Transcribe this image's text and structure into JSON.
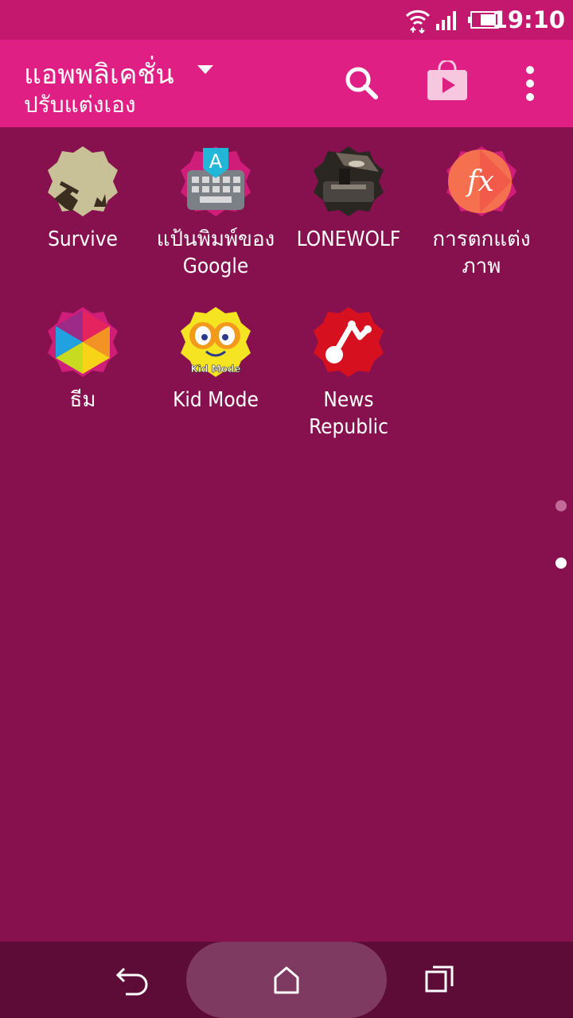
{
  "status_bar": {
    "time": "19:10",
    "icons": [
      "wifi-icon",
      "signal-icon",
      "battery-icon"
    ]
  },
  "app_bar": {
    "title": "แอพพลิเคชั่น",
    "subtitle": "ปรับแต่งเอง",
    "actions": [
      "search-icon",
      "play-store-icon",
      "overflow-menu-icon"
    ]
  },
  "apps": [
    {
      "label": "Survive",
      "icon": "survive-icon"
    },
    {
      "label": "แป้นพิมพ์ของ Google",
      "icon": "google-keyboard-icon"
    },
    {
      "label": "LONEWOLF",
      "icon": "lonewolf-icon"
    },
    {
      "label": "การตกแต่งภาพ",
      "icon": "photo-effects-icon",
      "icon_text": "fx"
    },
    {
      "label": "ธีม",
      "icon": "themes-icon"
    },
    {
      "label": "Kid Mode",
      "icon": "kid-mode-icon",
      "icon_text": "Kid Mode"
    },
    {
      "label": "News Republic",
      "icon": "news-republic-icon"
    }
  ],
  "page_indicator": {
    "pages": 2,
    "current": 2
  },
  "nav": [
    "back-icon",
    "home-icon",
    "recents-icon"
  ],
  "colors": {
    "status_bar": "#c4186e",
    "app_bar": "#df1f84",
    "background": "#87114e",
    "nav_bar": "#5d0b37"
  }
}
